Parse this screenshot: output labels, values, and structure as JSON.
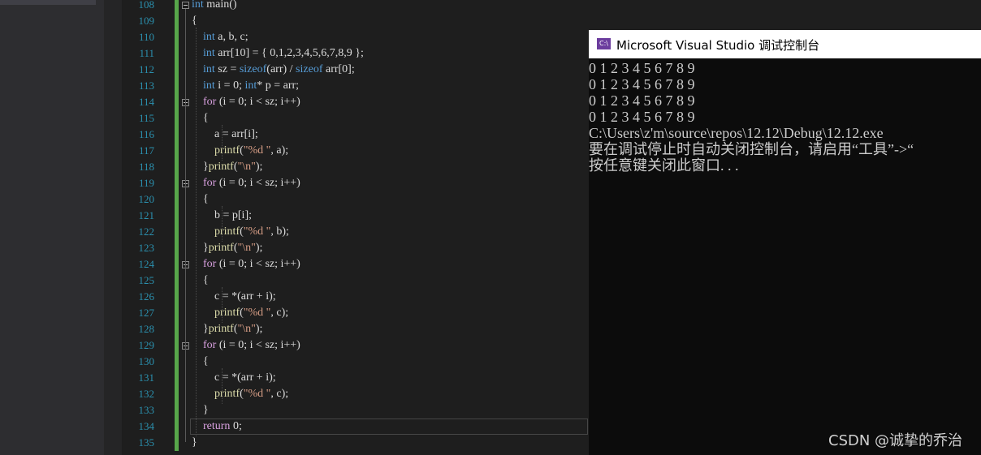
{
  "editor": {
    "line_numbers": [
      "108",
      "109",
      "110",
      "111",
      "112",
      "113",
      "114",
      "115",
      "116",
      "117",
      "118",
      "119",
      "120",
      "121",
      "122",
      "123",
      "124",
      "125",
      "126",
      "127",
      "128",
      "129",
      "130",
      "131",
      "132",
      "133",
      "134",
      "135"
    ],
    "code_lines": [
      [
        {
          "t": "int",
          "c": "kw"
        },
        {
          "t": " main()",
          "c": ""
        }
      ],
      [
        {
          "t": "{",
          "c": ""
        }
      ],
      [
        {
          "t": "    ",
          "c": ""
        },
        {
          "t": "int",
          "c": "kw"
        },
        {
          "t": " a, b, c;",
          "c": ""
        }
      ],
      [
        {
          "t": "    ",
          "c": ""
        },
        {
          "t": "int",
          "c": "kw"
        },
        {
          "t": " arr[10] = { 0,1,2,3,4,5,6,7,8,9 };",
          "c": ""
        }
      ],
      [
        {
          "t": "    ",
          "c": ""
        },
        {
          "t": "int",
          "c": "kw"
        },
        {
          "t": " sz = ",
          "c": ""
        },
        {
          "t": "sizeof",
          "c": "kw"
        },
        {
          "t": "(arr) / ",
          "c": ""
        },
        {
          "t": "sizeof",
          "c": "kw"
        },
        {
          "t": " arr[0];",
          "c": ""
        }
      ],
      [
        {
          "t": "    ",
          "c": ""
        },
        {
          "t": "int",
          "c": "kw"
        },
        {
          "t": " i = 0; ",
          "c": ""
        },
        {
          "t": "int",
          "c": "kw"
        },
        {
          "t": "* p = arr;",
          "c": ""
        }
      ],
      [
        {
          "t": "    ",
          "c": ""
        },
        {
          "t": "for",
          "c": "kw2"
        },
        {
          "t": " (i = 0; i < sz; i++)",
          "c": ""
        }
      ],
      [
        {
          "t": "    {",
          "c": ""
        }
      ],
      [
        {
          "t": "        a = arr[i];",
          "c": ""
        }
      ],
      [
        {
          "t": "        ",
          "c": ""
        },
        {
          "t": "printf",
          "c": "fn"
        },
        {
          "t": "(",
          "c": ""
        },
        {
          "t": "\"%d \"",
          "c": "str"
        },
        {
          "t": ", a);",
          "c": ""
        }
      ],
      [
        {
          "t": "    }",
          "c": ""
        },
        {
          "t": "printf",
          "c": "fn"
        },
        {
          "t": "(",
          "c": ""
        },
        {
          "t": "\"\\n\"",
          "c": "str"
        },
        {
          "t": ");",
          "c": ""
        }
      ],
      [
        {
          "t": "    ",
          "c": ""
        },
        {
          "t": "for",
          "c": "kw2"
        },
        {
          "t": " (i = 0; i < sz; i++)",
          "c": ""
        }
      ],
      [
        {
          "t": "    {",
          "c": ""
        }
      ],
      [
        {
          "t": "        b = p[i];",
          "c": ""
        }
      ],
      [
        {
          "t": "        ",
          "c": ""
        },
        {
          "t": "printf",
          "c": "fn"
        },
        {
          "t": "(",
          "c": ""
        },
        {
          "t": "\"%d \"",
          "c": "str"
        },
        {
          "t": ", b);",
          "c": ""
        }
      ],
      [
        {
          "t": "    }",
          "c": ""
        },
        {
          "t": "printf",
          "c": "fn"
        },
        {
          "t": "(",
          "c": ""
        },
        {
          "t": "\"\\n\"",
          "c": "str"
        },
        {
          "t": ");",
          "c": ""
        }
      ],
      [
        {
          "t": "    ",
          "c": ""
        },
        {
          "t": "for",
          "c": "kw2"
        },
        {
          "t": " (i = 0; i < sz; i++)",
          "c": ""
        }
      ],
      [
        {
          "t": "    {",
          "c": ""
        }
      ],
      [
        {
          "t": "        c = *(arr + i);",
          "c": ""
        }
      ],
      [
        {
          "t": "        ",
          "c": ""
        },
        {
          "t": "printf",
          "c": "fn"
        },
        {
          "t": "(",
          "c": ""
        },
        {
          "t": "\"%d \"",
          "c": "str"
        },
        {
          "t": ", c);",
          "c": ""
        }
      ],
      [
        {
          "t": "    }",
          "c": ""
        },
        {
          "t": "printf",
          "c": "fn"
        },
        {
          "t": "(",
          "c": ""
        },
        {
          "t": "\"\\n\"",
          "c": "str"
        },
        {
          "t": ");",
          "c": ""
        }
      ],
      [
        {
          "t": "    ",
          "c": ""
        },
        {
          "t": "for",
          "c": "kw2"
        },
        {
          "t": " (i = 0; i < sz; i++)",
          "c": ""
        }
      ],
      [
        {
          "t": "    {",
          "c": ""
        }
      ],
      [
        {
          "t": "        c = *(arr + i);",
          "c": ""
        }
      ],
      [
        {
          "t": "        ",
          "c": ""
        },
        {
          "t": "printf",
          "c": "fn"
        },
        {
          "t": "(",
          "c": ""
        },
        {
          "t": "\"%d \"",
          "c": "str"
        },
        {
          "t": ", c);",
          "c": ""
        }
      ],
      [
        {
          "t": "    }",
          "c": ""
        }
      ],
      [
        {
          "t": "    ",
          "c": ""
        },
        {
          "t": "return",
          "c": "kw2"
        },
        {
          "t": " 0;",
          "c": ""
        }
      ],
      [
        {
          "t": "}",
          "c": ""
        }
      ]
    ],
    "fold_lines": [
      0,
      6,
      11,
      16,
      21
    ]
  },
  "console": {
    "icon_text": "C:\\",
    "title": "Microsoft Visual Studio 调试控制台",
    "output_lines": [
      "0 1 2 3 4 5 6 7 8 9",
      "0 1 2 3 4 5 6 7 8 9",
      "0 1 2 3 4 5 6 7 8 9",
      "0 1 2 3 4 5 6 7 8 9",
      "C:\\Users\\z'm\\source\\repos\\12.12\\Debug\\12.12.exe",
      "要在调试停止时自动关闭控制台，请启用“工具”->“",
      "按任意键关闭此窗口. . ."
    ]
  },
  "watermark": "CSDN @诚挚的乔治"
}
